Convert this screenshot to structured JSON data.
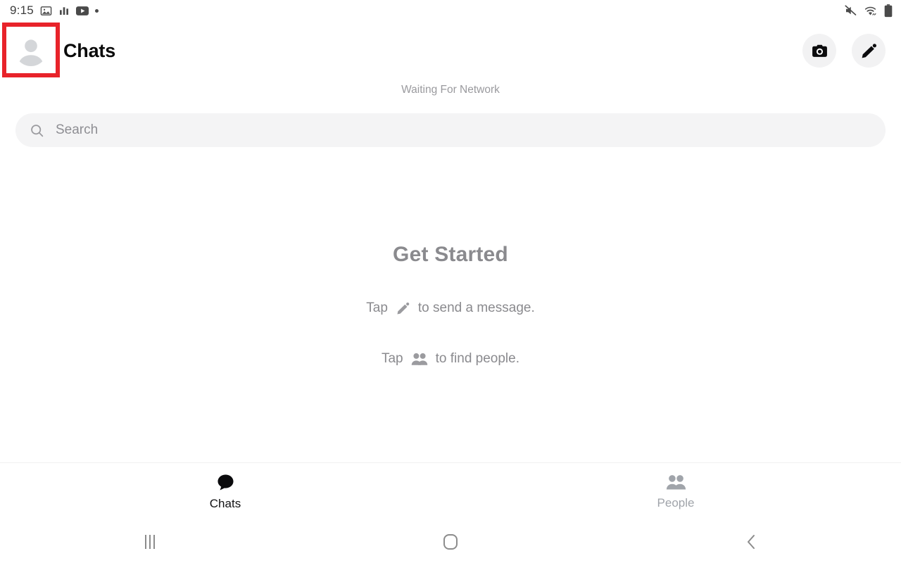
{
  "status_bar": {
    "time": "9:15",
    "left_icons": [
      {
        "name": "photos-icon"
      },
      {
        "name": "bar-chart-icon"
      },
      {
        "name": "youtube-icon"
      },
      {
        "name": "notification-dot-icon"
      }
    ],
    "right_icons": [
      {
        "name": "mute-icon"
      },
      {
        "name": "wifi-icon"
      },
      {
        "name": "battery-icon"
      }
    ]
  },
  "header": {
    "title": "Chats",
    "avatar_name": "profile-avatar",
    "camera_label": "Camera",
    "compose_label": "Compose"
  },
  "network_status": {
    "text": "Waiting For Network"
  },
  "search": {
    "placeholder": "Search",
    "value": ""
  },
  "empty_state": {
    "title": "Get Started",
    "hint_1_prefix": "Tap",
    "hint_1_suffix": "to send a message.",
    "hint_2_prefix": "Tap",
    "hint_2_suffix": "to find people."
  },
  "tabs": [
    {
      "label": "Chats",
      "active": true
    },
    {
      "label": "People",
      "active": false
    }
  ],
  "nav_bar": {
    "recents_label": "Recents",
    "home_label": "Home",
    "back_label": "Back"
  },
  "colors": {
    "highlight": "#e8232a",
    "accent_dark": "#111113",
    "muted": "#8a8a8e",
    "chip_bg": "#f2f2f3",
    "search_bg": "#f4f4f5"
  }
}
